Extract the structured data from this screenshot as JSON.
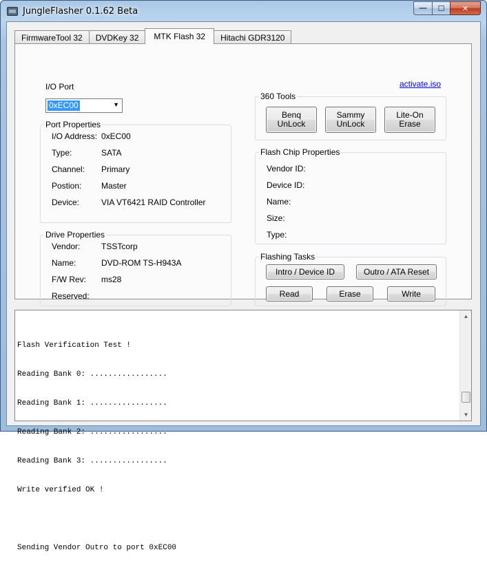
{
  "window": {
    "title": "JungleFlasher 0.1.62 Beta",
    "controls": {
      "minimize": "—",
      "maximize": "☐",
      "close": "✕"
    }
  },
  "tabs": [
    {
      "label": "FirmwareTool 32",
      "active": false
    },
    {
      "label": "DVDKey 32",
      "active": false
    },
    {
      "label": "MTK Flash 32",
      "active": true
    },
    {
      "label": "Hitachi GDR3120",
      "active": false
    }
  ],
  "io_port": {
    "label": "I/O Port",
    "selected": "0xEC00"
  },
  "activate_link": "activate.iso",
  "port_properties": {
    "title": "Port Properties",
    "rows": [
      {
        "key": "I/O Address:",
        "value": "0xEC00"
      },
      {
        "key": "Type:",
        "value": "SATA"
      },
      {
        "key": "Channel:",
        "value": "Primary"
      },
      {
        "key": "Postion:",
        "value": "Master"
      },
      {
        "key": "Device:",
        "value": "VIA VT6421 RAID Controller"
      }
    ]
  },
  "drive_properties": {
    "title": "Drive Properties",
    "rows": [
      {
        "key": "Vendor:",
        "value": "TSSTcorp"
      },
      {
        "key": "Name:",
        "value": "DVD-ROM TS-H943A"
      },
      {
        "key": "F/W Rev:",
        "value": "ms28"
      },
      {
        "key": "Reserved:",
        "value": ""
      }
    ]
  },
  "tools_360": {
    "title": "360 Tools",
    "benq": "Benq\nUnLock",
    "benq_l1": "Benq",
    "benq_l2": "UnLock",
    "sammy_l1": "Sammy",
    "sammy_l2": "UnLock",
    "liteon": "Lite-On Erase"
  },
  "flash_chip": {
    "title": "Flash Chip Properties",
    "rows": [
      {
        "key": "Vendor ID:"
      },
      {
        "key": "Device ID:"
      },
      {
        "key": "Name:"
      },
      {
        "key": "Size:"
      },
      {
        "key": "Type:"
      }
    ]
  },
  "flashing_tasks": {
    "title": "Flashing Tasks",
    "intro": "Intro / Device ID",
    "outro": "Outro / ATA Reset",
    "read": "Read",
    "erase": "Erase",
    "write": "Write"
  },
  "log": {
    "lines": [
      "Flash Verification Test !",
      "Reading Bank 0: .................",
      "Reading Bank 1: .................",
      "Reading Bank 2: .................",
      "Reading Bank 3: .................",
      "Write verified OK !",
      "",
      "Sending Vendor Outro to port 0xEC00"
    ]
  },
  "colors": {
    "titlebar": "#a9c8e6",
    "selection": "#3399ff",
    "link": "#0000ee"
  }
}
